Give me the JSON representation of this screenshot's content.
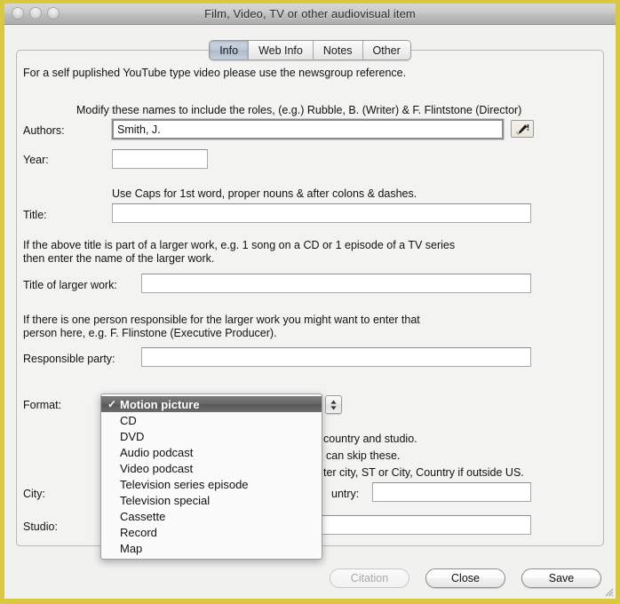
{
  "window": {
    "title": "Film, Video, TV or other audiovisual item",
    "border_color": "#d9c840",
    "traffic_lights": [
      "close",
      "minimize",
      "zoom"
    ]
  },
  "tabs": [
    {
      "label": "Info",
      "active": true
    },
    {
      "label": "Web Info",
      "active": false
    },
    {
      "label": "Notes",
      "active": false
    },
    {
      "label": "Other",
      "active": false
    }
  ],
  "form": {
    "intro_note": "For a self puplished YouTube type video please use the newsgroup reference.",
    "authors_hint": "Modify these names to include the roles, (e.g.) Rubble, B. (Writer) & F. Flintstone (Director)",
    "authors_label": "Authors:",
    "authors_value": "Smith, J.",
    "authors_icon": "pen-wand-icon",
    "year_label": "Year:",
    "year_value": "",
    "title_hint": "Use Caps for 1st word, proper nouns & after colons & dashes.",
    "title_label": "Title:",
    "title_value": "",
    "larger_work_hint": "If the above title is part of a larger work, e.g. 1 song on a CD or 1 episode of a TV series\nthen enter the name of the larger work.",
    "larger_work_label": "Title of larger work:",
    "larger_work_value": "",
    "responsible_hint": "If there is one person responsible for the larger work you might want to enter that\nperson here, e.g. F. Flinstone (Executive Producer).",
    "responsible_label": "Responsible party:",
    "responsible_value": "",
    "format_label": "Format:",
    "format_selected": "Motion picture",
    "occluded_hint_line1": "country and studio.",
    "occluded_hint_line2": "can skip these.",
    "occluded_hint_line3": "ter city, ST or City, Country if outside US.",
    "city_label": "City:",
    "city_value": "",
    "country_label": "untry:",
    "country_value": "",
    "studio_label": "Studio:",
    "studio_value": ""
  },
  "format_menu": {
    "open": true,
    "checkmark": "✓",
    "selected_index": 0,
    "items": [
      "Motion picture",
      "CD",
      "DVD",
      "Audio podcast",
      "Video podcast",
      "Television series episode",
      "Television special",
      "Cassette",
      "Record",
      "Map"
    ]
  },
  "buttons": [
    {
      "label": "Citation",
      "enabled": false
    },
    {
      "label": "Close",
      "enabled": true
    },
    {
      "label": "Save",
      "enabled": true
    }
  ]
}
